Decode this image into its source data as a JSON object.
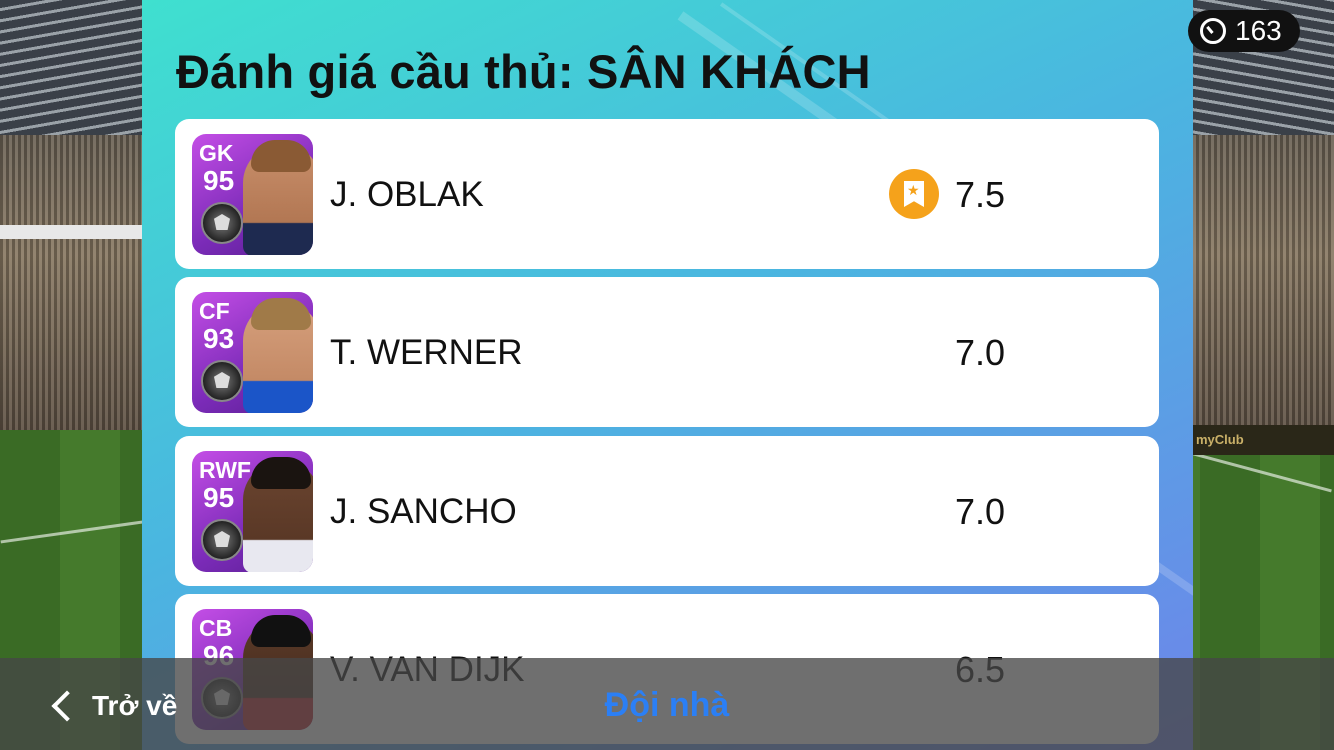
{
  "title": "Đánh giá cầu thủ: SÂN KHÁCH",
  "timer": "163",
  "players": [
    {
      "position": "GK",
      "overall": "95",
      "name": "J. OBLAK",
      "rating": "7.5",
      "best": true
    },
    {
      "position": "CF",
      "overall": "93",
      "name": "T. WERNER",
      "rating": "7.0",
      "best": false
    },
    {
      "position": "RWF",
      "overall": "95",
      "name": "J. SANCHO",
      "rating": "7.0",
      "best": false
    },
    {
      "position": "CB",
      "overall": "96",
      "name": "V. VAN DIJK",
      "rating": "6.5",
      "best": false
    }
  ],
  "bottom_bar": {
    "back_label": "Trở về",
    "tab_label": "Đội nhà"
  },
  "icons": {
    "back": "chevron-left-icon",
    "timer": "stopwatch-icon",
    "best_player": "star-bookmark-icon",
    "card_badge": "shield-badge-icon"
  },
  "colors": {
    "panel_start": "#3fe0cf",
    "panel_end": "#6e84ea",
    "card": "#9b3bd3",
    "highlight": "#f5a21b",
    "tab": "#2b7ff5"
  },
  "background": {
    "ad_board_right": "myClub"
  }
}
